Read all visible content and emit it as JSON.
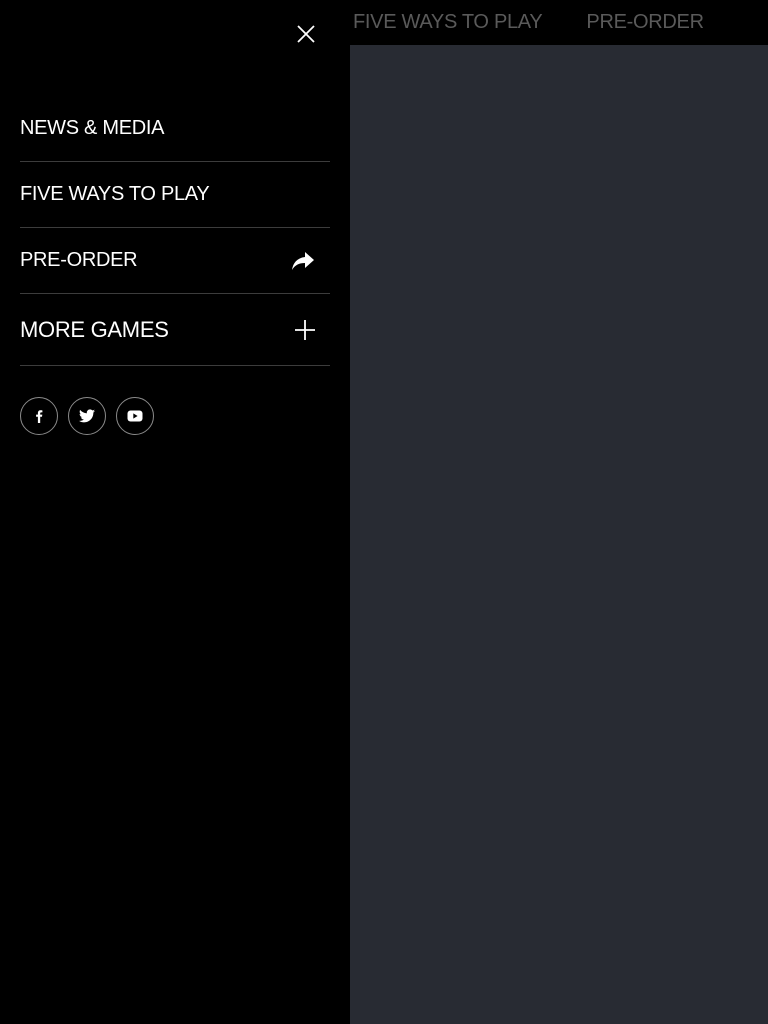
{
  "site": {
    "nav": [
      {
        "label": "FIVE WAYS TO PLAY"
      },
      {
        "label": "PRE-ORDER"
      }
    ]
  },
  "drawer": {
    "close_icon": "close-icon",
    "menu": [
      {
        "label": "NEWS & MEDIA"
      },
      {
        "label": "FIVE WAYS TO PLAY"
      },
      {
        "label": "PRE-ORDER",
        "icon": "share-arrow-icon"
      },
      {
        "label": "MORE GAMES",
        "icon": "plus-icon"
      }
    ],
    "social": [
      {
        "icon": "facebook-icon"
      },
      {
        "icon": "twitter-icon"
      },
      {
        "icon": "youtube-icon"
      }
    ]
  },
  "colors": {
    "drawer_bg": "#000000",
    "content_bg": "#282b33",
    "text": "#ffffff",
    "muted_nav": "#5a5a5a",
    "divider": "#3c3c3c"
  }
}
